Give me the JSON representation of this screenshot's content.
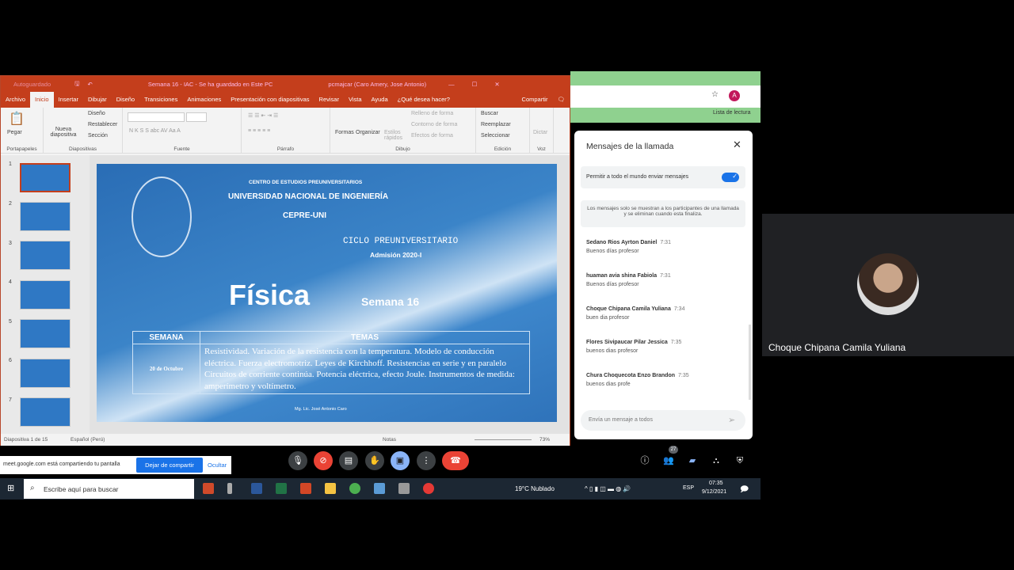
{
  "ppt": {
    "autosave": "Autoguardado",
    "title": "Semana 16 - IAC  -  Se ha guardado en Este PC",
    "user": "pcmajcar (Caro Amery, Jose Antonio)",
    "menu": [
      "Archivo",
      "Inicio",
      "Insertar",
      "Dibujar",
      "Diseño",
      "Transiciones",
      "Animaciones",
      "Presentación con diapositivas",
      "Revisar",
      "Vista",
      "Ayuda"
    ],
    "search": "¿Qué desea hacer?",
    "share": "Compartir",
    "ribbon": {
      "pegar": "Pegar",
      "nueva": "Nueva diapositiva",
      "diseno": "Diseño",
      "restablecer": "Restablecer",
      "seccion": "Sección",
      "formas": "Formas",
      "organizar": "Organizar",
      "estilos": "Estilos rápidos",
      "relleno": "Relleno de forma",
      "contorno": "Contorno de forma",
      "efectos": "Efectos de forma",
      "buscar": "Buscar",
      "reemplazar": "Reemplazar",
      "seleccionar": "Seleccionar",
      "dictar": "Dictar",
      "groups": [
        "Portapapeles",
        "Diapositivas",
        "Fuente",
        "Párrafo",
        "Dibujo",
        "Edición",
        "Voz"
      ]
    },
    "thumbs": [
      "1",
      "2",
      "3",
      "4",
      "5",
      "6",
      "7"
    ],
    "slide": {
      "centro": "CENTRO DE ESTUDIOS PREUNIVERSITARIOS",
      "uni": "UNIVERSIDAD NACIONAL DE INGENIERÍA",
      "cepre": "CEPRE-UNI",
      "ciclo": "CICLO PREUNIVERSITARIO",
      "admision": "Admisión 2020-I",
      "fisica": "Física",
      "semana": "Semana 16",
      "table": {
        "h1": "SEMANA",
        "h2": "TEMAS",
        "date": "20 de Octubre",
        "temas": "Resistividad. Variación de la resistencia con la temperatura. Modelo de conducción eléctrica. Fuerza electromotriz. Leyes de Kirchhoff. Resistencias en serie y en paralelo Circuitos de corriente continúa. Potencia eléctrica, efecto Joule. Instrumentos de medida: amperímetro y voltímetro."
      },
      "author": "Mg. Lic. José Antonio Caro"
    },
    "status": {
      "slide": "Diapositiva 1 de 15",
      "lang": "Español (Perú)",
      "notes": "Notas",
      "zoom": "73%"
    }
  },
  "chrome": {
    "reading_list": "Lista de lectura",
    "avatar": "A"
  },
  "chat": {
    "title": "Mensajes de la llamada",
    "allow": "Permitir a todo el mundo enviar mensajes",
    "allow_on": true,
    "notice": "Los mensajes solo se muestran a los participantes de una llamada y se eliminan cuando esta finaliza.",
    "messages": [
      {
        "name": "Sedano Rios Ayrton Daniel",
        "time": "7:31",
        "text": "Buenos días profesor"
      },
      {
        "name": "huaman avia shina Fabiola",
        "time": "7:31",
        "text": "Buenos días profesor"
      },
      {
        "name": "Choque Chipana Camila Yuliana",
        "time": "7:34",
        "text": "buen dia profesor"
      },
      {
        "name": "Flores Sivipaucar Pilar Jessica",
        "time": "7:35",
        "text": "buenos dias profesor"
      },
      {
        "name": "Chura Choquecota Enzo Brandon",
        "time": "7:35",
        "text": "buenos dias profe"
      }
    ],
    "placeholder": "Envía un mensaje a todos"
  },
  "participant": {
    "name": "Choque Chipana Camila Yuliana"
  },
  "meet": {
    "sharing": "meet.google.com está compartiendo tu pantalla",
    "stop": "Dejar de compartir",
    "hide": "Ocultar",
    "participants": "27"
  },
  "taskbar": {
    "search": "Escribe aquí para buscar",
    "weather": "19°C  Nublado",
    "lang": "ESP",
    "time": "07:35",
    "date": "9/12/2021"
  }
}
